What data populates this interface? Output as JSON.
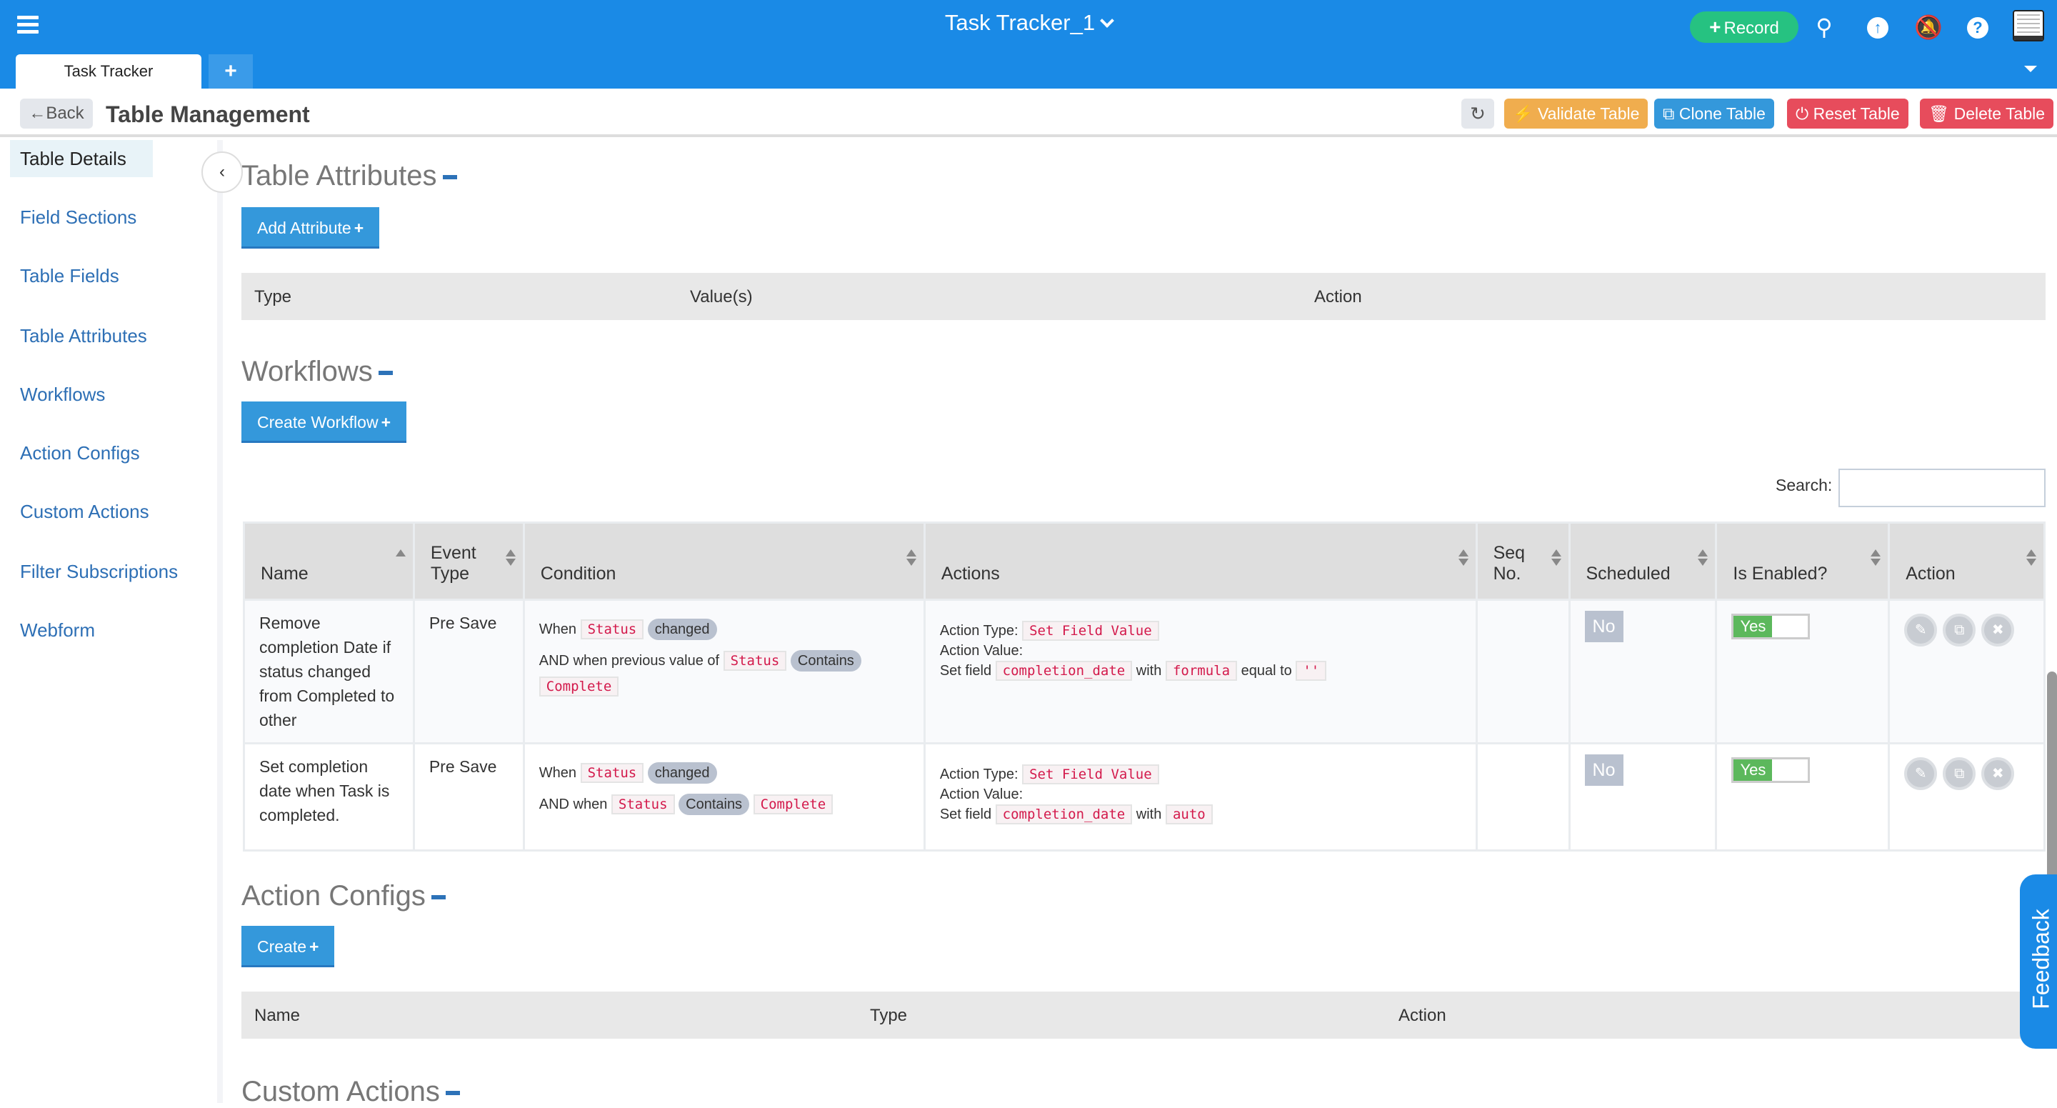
{
  "app": {
    "title": "Task Tracker_1",
    "tabs": [
      {
        "label": "Task Tracker"
      }
    ],
    "record_label": "Record",
    "brand_color": "#1a8ae6"
  },
  "subheader": {
    "back_label": "Back",
    "page_title": "Table Management",
    "buttons": {
      "validate": "Validate Table",
      "clone": "Clone Table",
      "reset": "Reset Table",
      "delete": "Delete Table"
    }
  },
  "sidebar": {
    "items": [
      {
        "label": "Table Details"
      },
      {
        "label": "Field Sections"
      },
      {
        "label": "Table Fields"
      },
      {
        "label": "Table Attributes"
      },
      {
        "label": "Workflows"
      },
      {
        "label": "Action Configs"
      },
      {
        "label": "Custom Actions"
      },
      {
        "label": "Filter Subscriptions"
      },
      {
        "label": "Webform"
      }
    ]
  },
  "sections": {
    "table_attributes": {
      "title": "Table Attributes",
      "add_button": "Add Attribute",
      "columns": [
        "Type",
        "Value(s)",
        "Action"
      ]
    },
    "workflows": {
      "title": "Workflows",
      "create_button": "Create Workflow",
      "search_label": "Search:",
      "search_value": "",
      "columns": [
        "Name",
        "Event Type",
        "Condition",
        "Actions",
        "Seq No.",
        "Scheduled",
        "Is Enabled?",
        "Action"
      ],
      "rows": [
        {
          "name": "Remove completion Date if status changed from Completed to other",
          "event_type": "Pre Save",
          "condition": {
            "line1": {
              "prefix": "When",
              "field": "Status",
              "op": "changed"
            },
            "line2": {
              "prefix": "AND when previous value of",
              "field": "Status",
              "op": "Contains",
              "value": "Complete"
            }
          },
          "actions": {
            "type_label": "Action Type:",
            "type": "Set Field Value",
            "value_label": "Action Value:",
            "set_field": "Set field",
            "field": "completion_date",
            "with": "with",
            "mode": "formula",
            "equal": "equal to",
            "value": "''"
          },
          "seq_no": "",
          "scheduled": "No",
          "enabled": "Yes"
        },
        {
          "name": "Set completion date when Task is completed.",
          "event_type": "Pre Save",
          "condition": {
            "line1": {
              "prefix": "When",
              "field": "Status",
              "op": "changed"
            },
            "line2": {
              "prefix": "AND when",
              "field": "Status",
              "op": "Contains",
              "value": "Complete"
            }
          },
          "actions": {
            "type_label": "Action Type:",
            "type": "Set Field Value",
            "value_label": "Action Value:",
            "set_field": "Set field",
            "field": "completion_date",
            "with": "with",
            "mode": "auto"
          },
          "seq_no": "",
          "scheduled": "No",
          "enabled": "Yes"
        }
      ]
    },
    "action_configs": {
      "title": "Action Configs",
      "create_button": "Create",
      "columns": [
        "Name",
        "Type",
        "Action"
      ]
    },
    "custom_actions": {
      "title": "Custom Actions"
    }
  },
  "feedback_label": "Feedback"
}
